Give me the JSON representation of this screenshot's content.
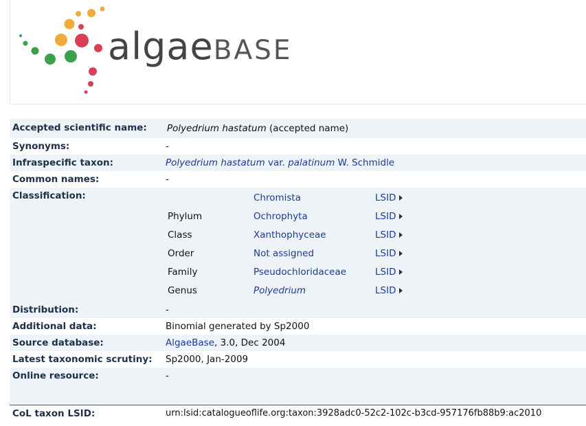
{
  "logo": {
    "word_part1": "algae",
    "word_part2": "BASE",
    "dot_colors": {
      "orange": "#f2a93b",
      "red": "#d94055",
      "green": "#3aa24a"
    }
  },
  "fields": {
    "accepted": {
      "label": "Accepted scientific name:",
      "name": "Polyedrium hastatum",
      "suffix": " (accepted name)"
    },
    "synonyms": {
      "label": "Synonyms:",
      "value": "-"
    },
    "infraspecific": {
      "label": "Infraspecific taxon:",
      "genus_species": "Polyedrium hastatum",
      "rank": " var. ",
      "epithet": "palatinum",
      "author": " W. Schmidle"
    },
    "common_names": {
      "label": "Common names:",
      "value": "-"
    },
    "classification": {
      "label": "Classification:",
      "lsid_label": "LSID",
      "rows": [
        {
          "rank": "",
          "name": "Chromista"
        },
        {
          "rank": "Phylum",
          "name": "Ochrophyta"
        },
        {
          "rank": "Class",
          "name": "Xanthophyceae"
        },
        {
          "rank": "Order",
          "name": "Not assigned"
        },
        {
          "rank": "Family",
          "name": "Pseudochloridaceae"
        },
        {
          "rank": "Genus",
          "name": "Polyedrium"
        }
      ]
    },
    "distribution": {
      "label": "Distribution:",
      "value": "-"
    },
    "additional": {
      "label": "Additional data:",
      "value": "Binomial generated by Sp2000"
    },
    "source": {
      "label": "Source database:",
      "link": "AlgaeBase",
      "rest": ", 3.0, Dec 2004"
    },
    "scrutiny": {
      "label": "Latest taxonomic scrutiny:",
      "value": "Sp2000, Jan-2009"
    },
    "online": {
      "label": "Online resource:",
      "value": "-"
    },
    "col_lsid": {
      "label": "CoL taxon LSID:",
      "value": "urn:lsid:catalogueoflife.org:taxon:3928adc0-52c2-102c-b3cd-957176fb88b9:ac2010"
    }
  }
}
